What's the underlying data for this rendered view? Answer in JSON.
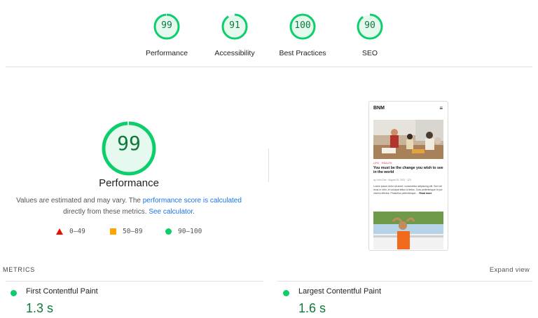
{
  "top_gauges": [
    {
      "label": "Performance",
      "score": "99",
      "fill": 0.99
    },
    {
      "label": "Accessibility",
      "score": "91",
      "fill": 0.91
    },
    {
      "label": "Best Practices",
      "score": "100",
      "fill": 1.0
    },
    {
      "label": "SEO",
      "score": "90",
      "fill": 0.9
    }
  ],
  "main": {
    "score": "99",
    "fill": 0.99,
    "title": "Performance",
    "desc_prefix": "Values are estimated and may vary. The ",
    "desc_link1": "performance score is calculated",
    "desc_middle": " directly from these metrics. ",
    "desc_link2": "See calculator",
    "desc_suffix": "."
  },
  "legend": [
    {
      "icon": "red-triangle-icon",
      "range": "0–49",
      "color": "#eb0f00"
    },
    {
      "icon": "orange-square-icon",
      "range": "50–89",
      "color": "#ffa400"
    },
    {
      "icon": "green-circle-icon",
      "range": "90–100",
      "color": "#0cce6b"
    }
  ],
  "preview": {
    "logo": "BNM",
    "menu_icon": "menu-icon",
    "tags": "LIFE · HEALTH",
    "headline": "You must be the change you wish to see in the world",
    "meta": "by John Doe · August 25, 2021 · 123",
    "excerpt": "Lorem ipsum dolor sit amet, consectetur adipiscing elit. Sed vel risus in nibh, et volutpat tellus id tellus. Cras pellentesque id pur viverra efficitur. Phasellus pellentesque ...",
    "read_more": "Read more"
  },
  "metrics": {
    "heading": "METRICS",
    "expand": "Expand view",
    "items": [
      {
        "name": "First Contentful Paint",
        "value": "1.3 s",
        "color": "#0cce6b"
      },
      {
        "name": "Largest Contentful Paint",
        "value": "1.6 s",
        "color": "#0cce6b"
      }
    ]
  },
  "colors": {
    "pass": "#0cce6b",
    "pass_text": "#0d7a3a",
    "link": "#1a73e8"
  }
}
